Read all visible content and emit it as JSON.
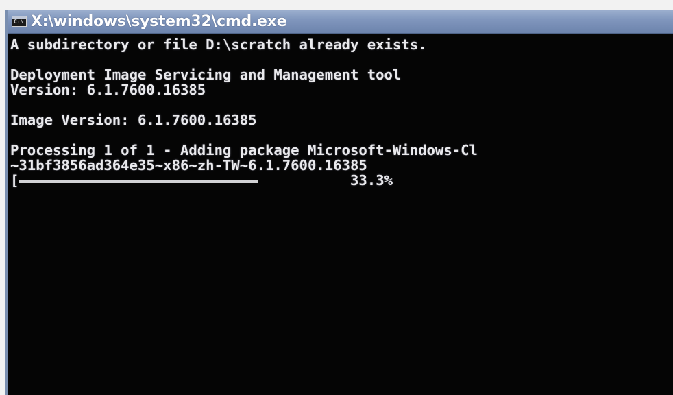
{
  "window": {
    "title": "X:\\windows\\system32\\cmd.exe",
    "icon": "cmd-icon"
  },
  "console": {
    "lines": [
      "A subdirectory or file D:\\scratch already exists.",
      "",
      "Deployment Image Servicing and Management tool",
      "Version: 6.1.7600.16385",
      "",
      "Image Version: 6.1.7600.16385",
      "",
      "Processing 1 of 1 - Adding package Microsoft-Windows-Cl",
      "~31bf3856ad364e35~x86~zh-TW~6.1.7600.16385"
    ],
    "progress": {
      "bracket": "[",
      "percent_text": "33.3%",
      "fraction": 0.333
    }
  },
  "colors": {
    "console_bg": "#050505",
    "console_text": "#e9e9ec",
    "titlebar": "#7f95bc"
  }
}
